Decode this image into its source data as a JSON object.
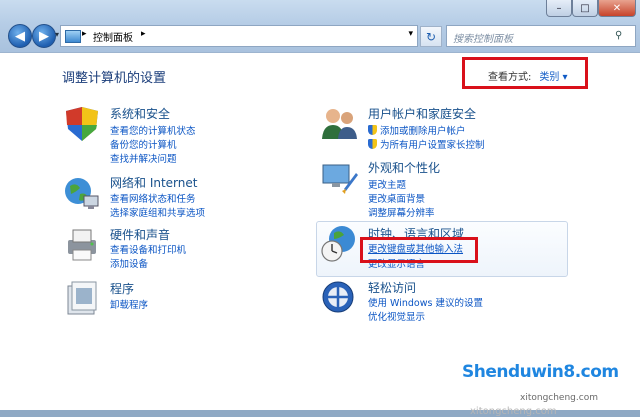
{
  "window": {
    "controls": {
      "minimize": "–",
      "maximize": "□",
      "close": "✕"
    }
  },
  "toolbar": {
    "back_icon": "back-arrow-icon",
    "forward_icon": "forward-arrow-icon",
    "breadcrumb": "控制面板",
    "breadcrumb_sep": "▸",
    "search_placeholder": "搜索控制面板"
  },
  "main": {
    "title": "调整计算机的设置",
    "view_by_label": "查看方式:",
    "view_by_value": "类别 ▾"
  },
  "categories": [
    {
      "title": "系统和安全",
      "links": [
        "查看您的计算机状态",
        "备份您的计算机",
        "查找并解决问题"
      ]
    },
    {
      "title": "网络和 Internet",
      "links": [
        "查看网络状态和任务",
        "选择家庭组和共享选项"
      ]
    },
    {
      "title": "硬件和声音",
      "links": [
        "查看设备和打印机",
        "添加设备"
      ]
    },
    {
      "title": "程序",
      "links": [
        "卸载程序"
      ]
    },
    {
      "title": "用户帐户和家庭安全",
      "links": [
        "添加或删除用户帐户",
        "为所有用户设置家长控制"
      ]
    },
    {
      "title": "外观和个性化",
      "links": [
        "更改主题",
        "更改桌面背景",
        "调整屏幕分辨率"
      ]
    },
    {
      "title": "时钟、语言和区域",
      "links": [
        "更改键盘或其他输入法",
        "更改显示语言"
      ]
    },
    {
      "title": "轻松访问",
      "links": [
        "使用 Windows 建议的设置",
        "优化视觉显示"
      ]
    }
  ],
  "watermark": {
    "line1": "xitongcheng.com",
    "line2": "Shenduwin8.com",
    "line3": "xitongcheng.com"
  },
  "colors": {
    "highlight": "#d9101a",
    "link": "#0b55c4",
    "title": "#19518c"
  }
}
